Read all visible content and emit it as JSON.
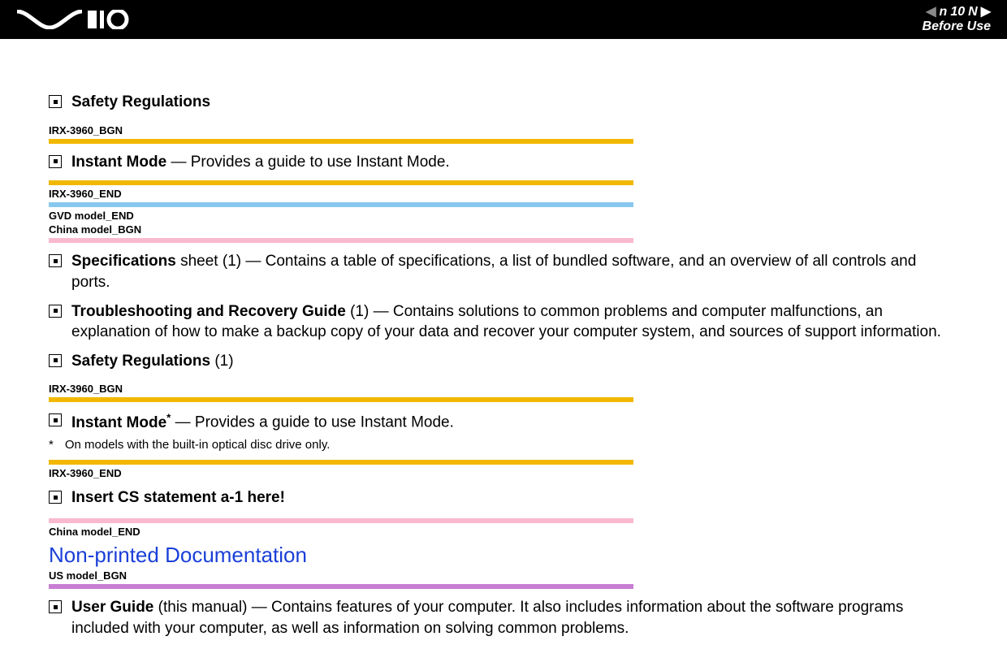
{
  "header": {
    "page_number": "10",
    "section": "Before Use",
    "nav_letter": "n",
    "nav_letter2": "N"
  },
  "items": [
    {
      "bold": "Safety Regulations",
      "rest": ""
    }
  ],
  "tag1": "IRX-3960_BGN",
  "item2": {
    "bold": "Instant Mode",
    "rest": " — Provides a guide to use Instant Mode."
  },
  "tag2": "IRX-3960_END",
  "tag3": "GVD model_END",
  "tag4": "China model_BGN",
  "item3": {
    "bold": "Specifications",
    "rest": " sheet (1) — Contains a table of specifications, a list of bundled software, and an overview of all controls and ports."
  },
  "item4": {
    "bold": "Troubleshooting and Recovery Guide",
    "rest": " (1) — Contains solutions to common problems and computer malfunctions, an explanation of how to make a backup copy of your data and recover your computer system, and sources of support information."
  },
  "item5": {
    "bold": "Safety Regulations",
    "rest": " (1)"
  },
  "tag5": "IRX-3960_BGN",
  "item6": {
    "bold": "Instant Mode",
    "sup": "*",
    "rest": " — Provides a guide to use Instant Mode."
  },
  "footnote": {
    "mark": "*",
    "text": "On models with the built-in optical disc drive only."
  },
  "tag6": "IRX-3960_END",
  "item7": {
    "bold": "Insert CS statement a-1 here!",
    "rest": ""
  },
  "tag7": "China model_END",
  "section_title": "Non-printed Documentation",
  "tag8": "US model_BGN",
  "item8": {
    "bold": "User Guide",
    "rest": " (this manual) — Contains features of your computer. It also includes information about the software programs included with your computer, as well as information on solving common problems."
  }
}
